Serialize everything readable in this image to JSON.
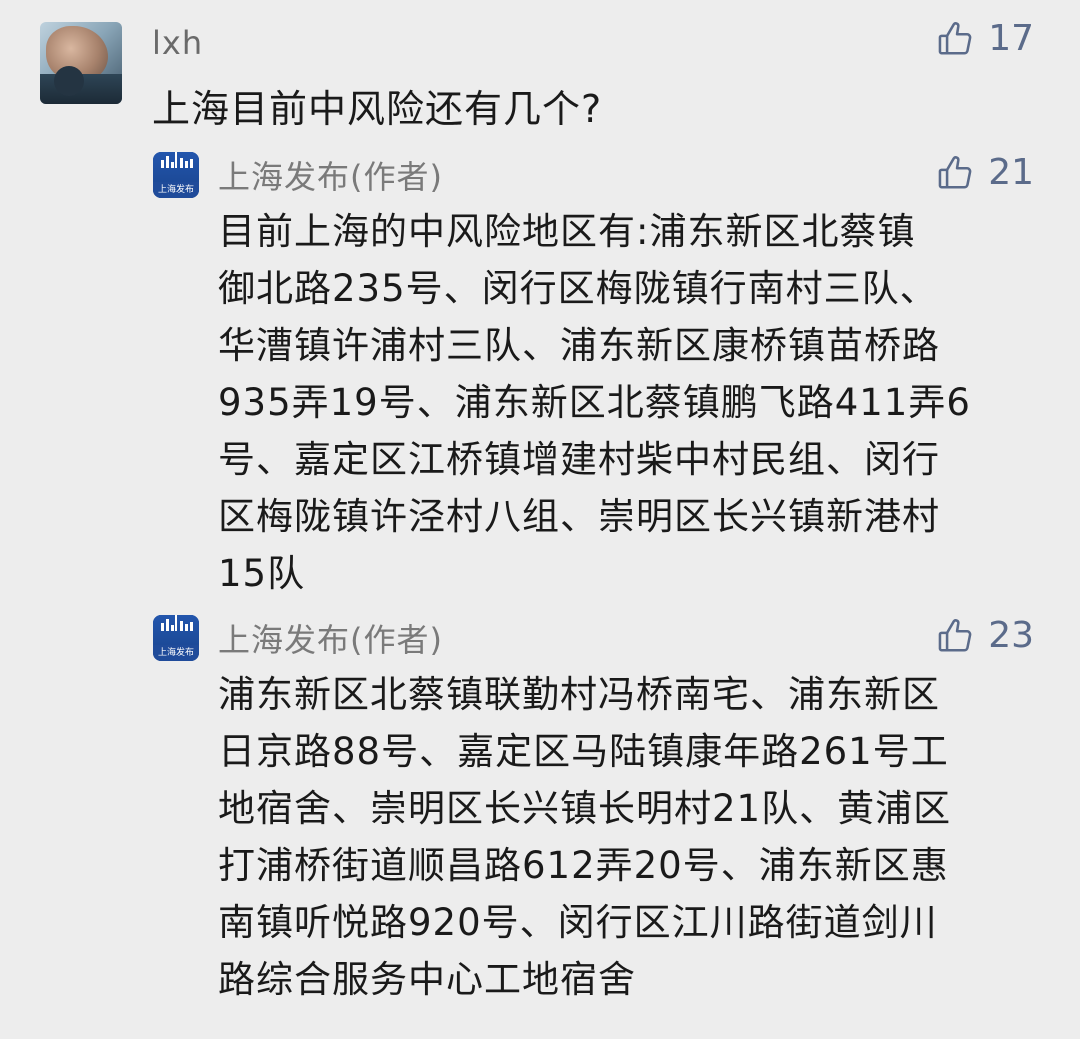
{
  "comment": {
    "username": "lxh",
    "text": "上海目前中风险还有几个?",
    "likes": "17",
    "avatar_icon": "user-photo-avatar"
  },
  "replies": [
    {
      "author": "上海发布(作者)",
      "avatar_icon": "shanghai-fabu-logo",
      "avatar_text": "上海发布",
      "likes": "21",
      "text": "目前上海的中风险地区有:浦东新区北蔡镇\n御北路235号、闵行区梅陇镇行南村三队、\n华漕镇许浦村三队、浦东新区康桥镇苗桥路\n935弄19号、浦东新区北蔡镇鹏飞路411弄6\n号、嘉定区江桥镇增建村柴中村民组、闵行\n区梅陇镇许泾村八组、崇明区长兴镇新港村\n15队"
    },
    {
      "author": "上海发布(作者)",
      "avatar_icon": "shanghai-fabu-logo",
      "avatar_text": "上海发布",
      "likes": "23",
      "text": "浦东新区北蔡镇联勤村冯桥南宅、浦东新区\n日京路88号、嘉定区马陆镇康年路261号工\n地宿舍、崇明区长兴镇长明村21队、黄浦区\n打浦桥街道顺昌路612弄20号、浦东新区惠\n南镇听悦路920号、闵行区江川路街道剑川\n路综合服务中心工地宿舍"
    }
  ],
  "colors": {
    "background": "#ededed",
    "like_icon": "#5b6b8a",
    "author_logo": "#1f4b9a"
  }
}
